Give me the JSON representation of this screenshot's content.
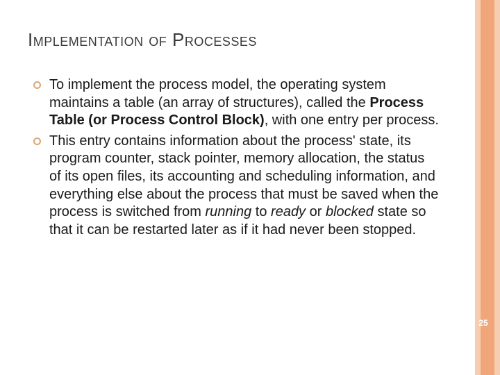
{
  "title": "Implementation of Processes",
  "bullets": [
    {
      "pre": "To implement the process model, the operating system maintains a table (an array of structures), called the ",
      "bold": "Process Table (or Process Control Block)",
      "post": ", with one entry per process."
    },
    {
      "pre": "This entry contains information about the process' state, its program counter, stack pointer, memory allocation, the status of its open files, its accounting and scheduling information, and everything else about the process that must be saved when the process is switched from ",
      "it1": "running",
      "mid1": " to ",
      "it2": "ready",
      "mid2": " or ",
      "it3": "blocked",
      "post": " state so that it can be restarted later as if it had never been stopped."
    }
  ],
  "page_number": "25"
}
